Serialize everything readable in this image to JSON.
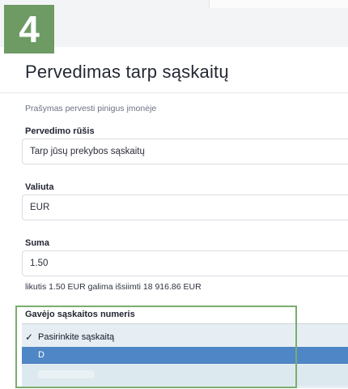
{
  "step": {
    "number": "4"
  },
  "page": {
    "title": "Pervedimas tarp sąskaitų",
    "subtitle": "Prašymas pervesti pinigus įmonėje"
  },
  "form": {
    "transfer_type": {
      "label": "Pervedimo rūšis",
      "value": "Tarp jūsų prekybos sąskaitų"
    },
    "currency": {
      "label": "Valiuta",
      "value": "EUR"
    },
    "amount": {
      "label": "Suma",
      "value": "1.50"
    },
    "hint": "likutis 1.50 EUR galima išsiimti 18 916.86 EUR",
    "recipient_account": {
      "label": "Gavėjo sąskaitos numeris",
      "options": [
        {
          "label": "Pasirinkite sąskaitą",
          "checked": true
        },
        {
          "label": "D",
          "highlighted": true
        }
      ]
    }
  },
  "colors": {
    "badge": "#6d9b63",
    "highlight_frame": "#7bac6f",
    "option_highlight": "#4f86c6"
  }
}
